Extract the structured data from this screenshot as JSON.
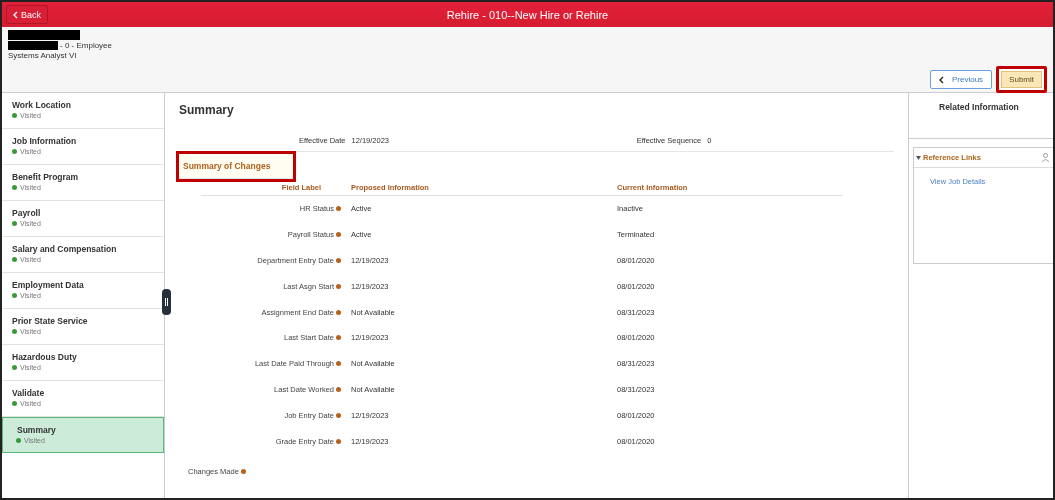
{
  "header": {
    "back": "Back",
    "title": "Rehire - 010--New Hire or Rehire"
  },
  "employee": {
    "name_redacted": true,
    "id_suffix": "- 0 - Employee",
    "job_title": "Systems Analyst VI"
  },
  "actions": [
    {
      "kind": "previous",
      "label": "Previous",
      "highlighted": false
    },
    {
      "kind": "submit",
      "label": "Submit",
      "highlighted": true
    }
  ],
  "steps": [
    {
      "label": "Work Location",
      "status": "Visited",
      "selected": false
    },
    {
      "label": "Job Information",
      "status": "Visited",
      "selected": false
    },
    {
      "label": "Benefit Program",
      "status": "Visited",
      "selected": false
    },
    {
      "label": "Payroll",
      "status": "Visited",
      "selected": false
    },
    {
      "label": "Salary and Compensation",
      "status": "Visited",
      "selected": false
    },
    {
      "label": "Employment Data",
      "status": "Visited",
      "selected": false
    },
    {
      "label": "Prior State Service",
      "status": "Visited",
      "selected": false
    },
    {
      "label": "Hazardous Duty",
      "status": "Visited",
      "selected": false
    },
    {
      "label": "Validate",
      "status": "Visited",
      "selected": false
    },
    {
      "label": "Summary",
      "status": "Visited",
      "selected": true
    }
  ],
  "summary": {
    "title": "Summary",
    "effective_date_label": "Effective Date",
    "effective_date": "12/19/2023",
    "sequence_label": "Effective Sequence",
    "sequence": "0",
    "section_title": "Summary of Changes",
    "section_highlighted": true,
    "columns": [
      "Field Label",
      "Proposed Information",
      "Current Information"
    ],
    "rows": [
      [
        "HR Status",
        "Active",
        "Inactive"
      ],
      [
        "Payroll Status",
        "Active",
        "Terminated"
      ],
      [
        "Department Entry Date",
        "12/19/2023",
        "08/01/2020"
      ],
      [
        "Last Asgn Start",
        "12/19/2023",
        "08/01/2020"
      ],
      [
        "Assignment End Date",
        "Not Available",
        "08/31/2023"
      ],
      [
        "Last Start Date",
        "12/19/2023",
        "08/01/2020"
      ],
      [
        "Last Date Paid Through",
        "Not Available",
        "08/31/2023"
      ],
      [
        "Last Date Worked",
        "Not Available",
        "08/31/2023"
      ],
      [
        "Job Entry Date",
        "12/19/2023",
        "08/01/2020"
      ],
      [
        "Grade Entry Date",
        "12/19/2023",
        "08/01/2020"
      ]
    ],
    "changes_made": "Changes Made"
  },
  "related": {
    "title": "Related Information",
    "section": "Reference Links",
    "expanded": true,
    "links": [
      "View Job Details"
    ]
  }
}
